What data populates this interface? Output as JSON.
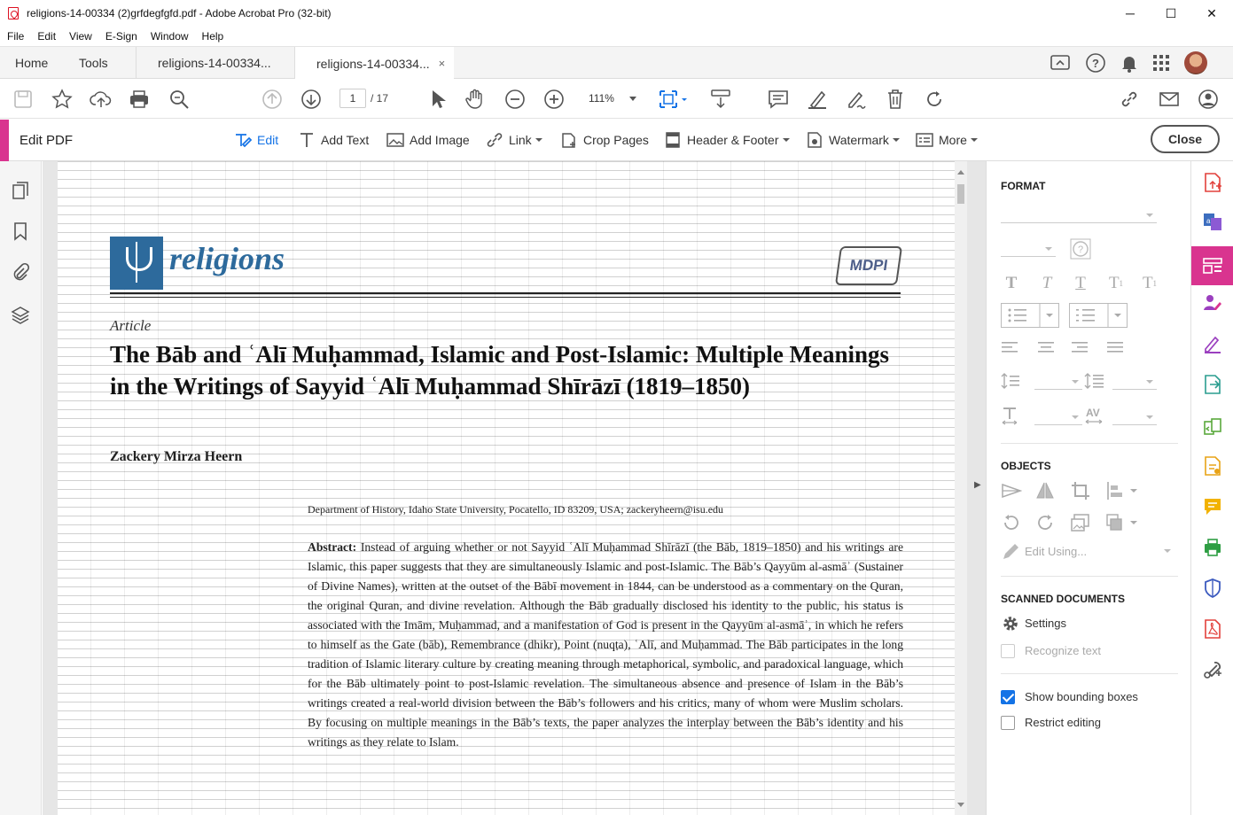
{
  "window": {
    "title": "religions-14-00334 (2)grfdegfgfd.pdf - Adobe Acrobat Pro (32-bit)",
    "minimize": "─",
    "maximize": "☐",
    "close": "✕"
  },
  "menu": [
    "File",
    "Edit",
    "View",
    "E-Sign",
    "Window",
    "Help"
  ],
  "tabs": {
    "home": "Home",
    "tools": "Tools",
    "doc1": "religions-14-00334...",
    "doc2": "religions-14-00334...",
    "close_glyph": "×"
  },
  "toolbar": {
    "page_current": "1",
    "page_total": "/ 17",
    "zoom": "111%"
  },
  "edit_bar": {
    "label": "Edit PDF",
    "tools": [
      {
        "label": "Edit",
        "icon": "edit-text-icon"
      },
      {
        "label": "Add Text",
        "icon": "add-text-icon"
      },
      {
        "label": "Add Image",
        "icon": "add-image-icon"
      },
      {
        "label": "Link",
        "icon": "link-icon"
      },
      {
        "label": "Crop Pages",
        "icon": "crop-icon"
      },
      {
        "label": "Header & Footer",
        "icon": "header-footer-icon"
      },
      {
        "label": "Watermark",
        "icon": "watermark-icon"
      },
      {
        "label": "More",
        "icon": "more-icon"
      }
    ],
    "close_label": "Close"
  },
  "document": {
    "journal": "religions",
    "publisher": "MDPI",
    "article_type": "Article",
    "title": "The Bāb and ʿAlī Muḥammad, Islamic and Post-Islamic: Multiple Meanings in the Writings of Sayyid ʿAlī Muḥammad Shīrāzī (1819–1850)",
    "author": "Zackery Mirza Heern",
    "affiliation": "Department of History, Idaho State University, Pocatello, ID 83209, USA; zackeryheern@isu.edu",
    "abstract_label": "Abstract:",
    "abstract": "Instead of arguing whether or not Sayyid ʿAlī Muḥammad Shīrāzī (the Bāb, 1819–1850) and his writings are Islamic, this paper suggests that they are simultaneously Islamic and post-Islamic. The Bāb’s Qayyūm al-asmāʾ (Sustainer of Divine Names), written at the outset of the Bābī movement in 1844, can be understood as a commentary on the Quran, the original Quran, and divine revelation. Although the Bāb gradually disclosed his identity to the public, his status is associated with the Imām, Muḥammad, and a manifestation of God is present in the Qayyūm al-asmāʾ, in which he refers to himself as the Gate (bāb), Remembrance (dhikr), Point (nuqṭa), ʿAlī, and Muḥammad. The Bāb participates in the long tradition of Islamic literary culture by creating meaning through metaphorical, symbolic, and paradoxical language, which for the Bāb ultimately point to post-Islamic revelation. The simultaneous absence and presence of Islam in the Bāb’s writings created a real-world division between the Bāb’s followers and his critics, many of whom were Muslim scholars. By focusing on multiple meanings in the Bāb’s texts, the paper analyzes the interplay between the Bāb’s identity and his writings as they relate to Islam."
  },
  "format_panel": {
    "format_header": "FORMAT",
    "objects_header": "OBJECTS",
    "edit_using": "Edit Using...",
    "scanned_header": "SCANNED DOCUMENTS",
    "settings": "Settings",
    "recognize_text": "Recognize text",
    "show_bounding_boxes": "Show bounding boxes",
    "restrict_editing": "Restrict editing",
    "show_bounding_boxes_checked": true,
    "restrict_editing_checked": false
  },
  "colors": {
    "accent_pink": "#d9348f",
    "link_blue": "#1473e6",
    "journal_blue": "#2d6a9c"
  }
}
